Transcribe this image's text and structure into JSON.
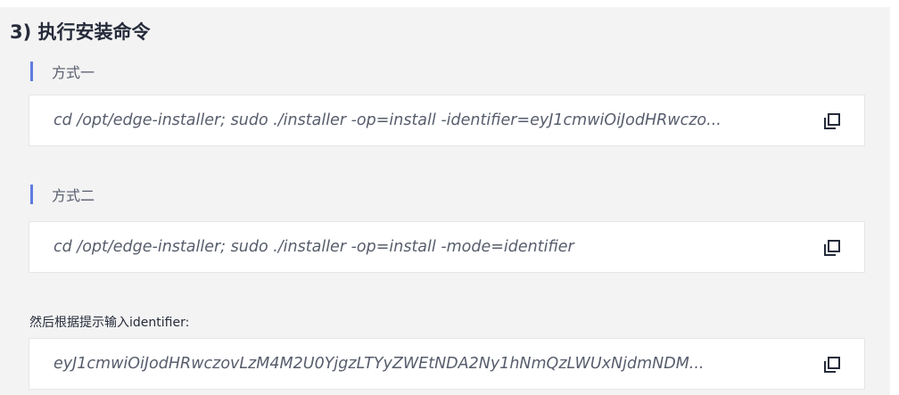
{
  "section": {
    "title": "3) 执行安装命令"
  },
  "methods": [
    {
      "label": "方式一",
      "command": "cd /opt/edge-installer; sudo ./installer -op=install -identifier=eyJ1cmwiOiJodHRwczo...",
      "copy_icon": "copy-icon"
    },
    {
      "label": "方式二",
      "command": "cd /opt/edge-installer; sudo ./installer -op=install -mode=identifier",
      "copy_icon": "copy-icon"
    }
  ],
  "identifier": {
    "note": "然后根据提示输入identifier:",
    "value": "eyJ1cmwiOiJodHRwczovLzM4M2U0YjgzLTYyZWEtNDA2Ny1hNmQzLWUxNjdmNDM...",
    "copy_icon": "copy-icon"
  },
  "colors": {
    "accent": "#5e7ce0",
    "panel_background": "#f3f3f3",
    "text": "#575d6c"
  }
}
